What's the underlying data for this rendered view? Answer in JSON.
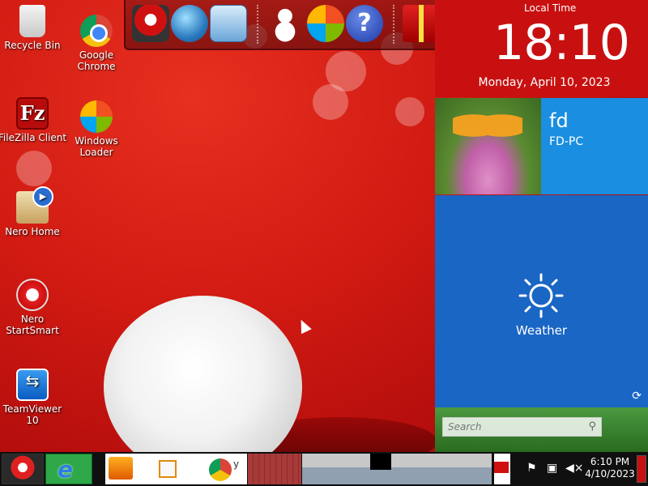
{
  "desktop": {
    "icons": [
      {
        "label": "Recycle Bin"
      },
      {
        "label": "Google Chrome"
      },
      {
        "label": "FileZilla Client"
      },
      {
        "label": "Windows Loader"
      },
      {
        "label": "Nero Home"
      },
      {
        "label": "Nero StartSmart"
      },
      {
        "label": "TeamViewer 10"
      }
    ]
  },
  "dock": {
    "items": [
      "santa-icon",
      "globe-icon",
      "control-panel-icon",
      "snowman-icon",
      "windows-logo-icon",
      "help-icon",
      "gift-icon",
      "folder-icon",
      "recycle-bin-icon"
    ],
    "help_glyph": "?"
  },
  "clock": {
    "label": "Local Time",
    "time": "18:10",
    "date": "Monday, April 10, 2023"
  },
  "user_tile": {
    "name": "fd",
    "computer": "FD-PC"
  },
  "weather_tile": {
    "label": "Weather"
  },
  "search": {
    "placeholder": "Search"
  },
  "filezilla_glyph": "Fz",
  "taskbar": {
    "thumb_letter": "y",
    "tray_time": "6:10 PM",
    "tray_date": "4/10/2023"
  },
  "colors": {
    "wallpaper_red": "#c81414",
    "clock_red": "#c81010",
    "user_tile_blue": "#1a8ee0",
    "weather_tile_blue": "#1a66c4",
    "taskbar": "#101010"
  }
}
